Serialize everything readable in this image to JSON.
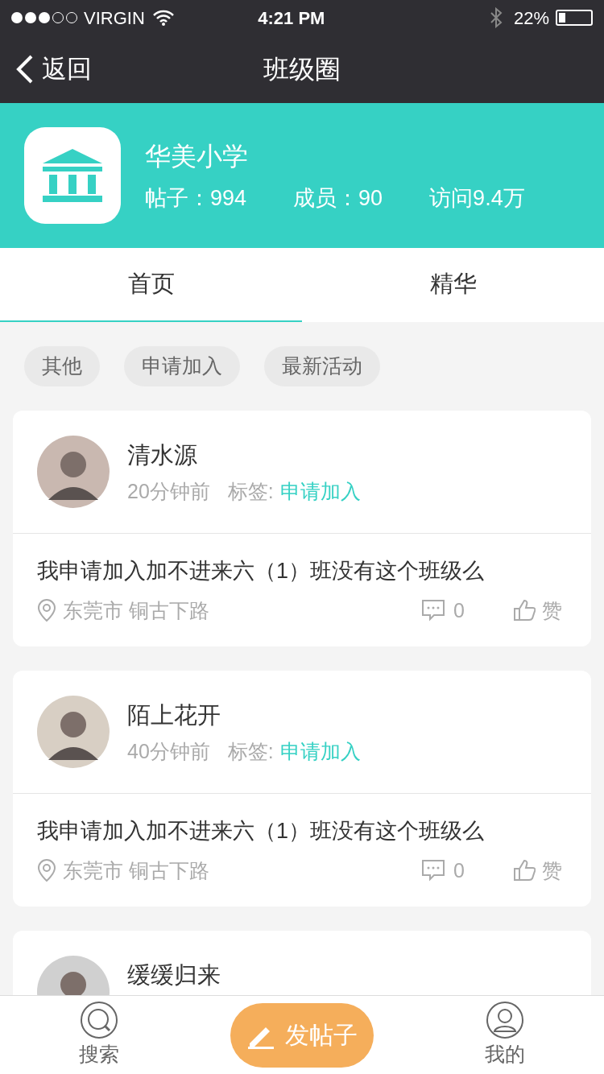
{
  "status_bar": {
    "carrier": "VIRGIN",
    "time": "4:21 PM",
    "battery": "22%"
  },
  "nav": {
    "back": "返回",
    "title": "班级圈"
  },
  "group": {
    "name": "华美小学",
    "stats": [
      "帖子：994",
      "成员：90",
      "访问9.4万"
    ]
  },
  "tabs": [
    {
      "label": "首页",
      "selected": true
    },
    {
      "label": "精华",
      "selected": false
    }
  ],
  "chips": [
    "其他",
    "申请加入",
    "最新活动"
  ],
  "posts": [
    {
      "author": "清水源",
      "time": "20分钟前",
      "tag_label": "标签:",
      "tag": "申请加入",
      "text": "我申请加入加不进来六（1）班没有这个班级么",
      "location": "东莞市 铜古下路",
      "comments": "0",
      "like": "赞"
    },
    {
      "author": "陌上花开",
      "time": "40分钟前",
      "tag_label": "标签:",
      "tag": "申请加入",
      "text": "我申请加入加不进来六（1）班没有这个班级么",
      "location": "东莞市 铜古下路",
      "comments": "0",
      "like": "赞"
    },
    {
      "author": "缓缓归来"
    }
  ],
  "bottom_bar": {
    "search": "搜索",
    "post": "发帖子",
    "me": "我的"
  }
}
